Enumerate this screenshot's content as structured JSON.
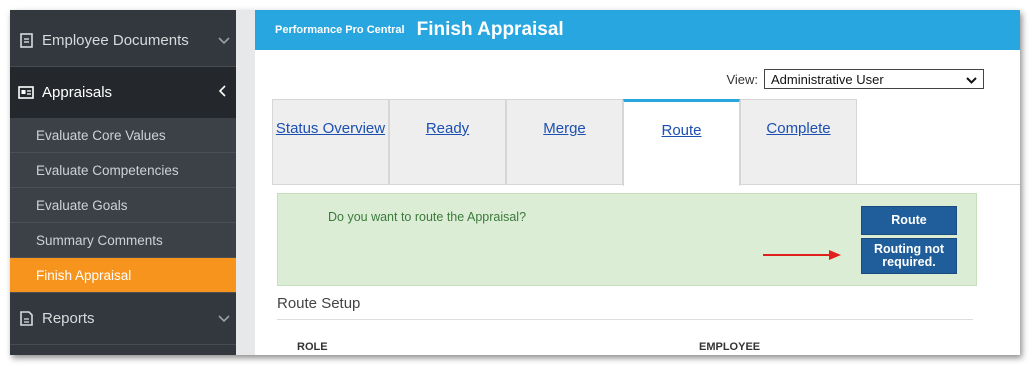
{
  "sidebar": {
    "items": [
      {
        "label": "Employee Documents",
        "icon": "document-icon"
      },
      {
        "label": "Appraisals",
        "icon": "id-card-icon"
      },
      {
        "label": "Reports",
        "icon": "report-icon"
      }
    ],
    "subitems": [
      {
        "label": "Evaluate Core Values"
      },
      {
        "label": "Evaluate Competencies"
      },
      {
        "label": "Evaluate Goals"
      },
      {
        "label": "Summary Comments"
      },
      {
        "label": "Finish Appraisal"
      }
    ],
    "accent_color": "#f7941d"
  },
  "header": {
    "app_name": "Performance Pro Central",
    "title": "Finish Appraisal",
    "color": "#27a6e0"
  },
  "view": {
    "label": "View:",
    "selected": "Administrative User"
  },
  "tabs": [
    {
      "label": "Status Overview"
    },
    {
      "label": "Ready"
    },
    {
      "label": "Merge"
    },
    {
      "label": "Route"
    },
    {
      "label": "Complete"
    }
  ],
  "alert": {
    "message": "Do you want to route the Appraisal?",
    "route_button": "Route",
    "no_route_button_line1": "Routing not",
    "no_route_button_line2": "required."
  },
  "route_setup": {
    "title": "Route Setup",
    "columns": [
      "ROLE",
      "EMPLOYEE"
    ]
  }
}
